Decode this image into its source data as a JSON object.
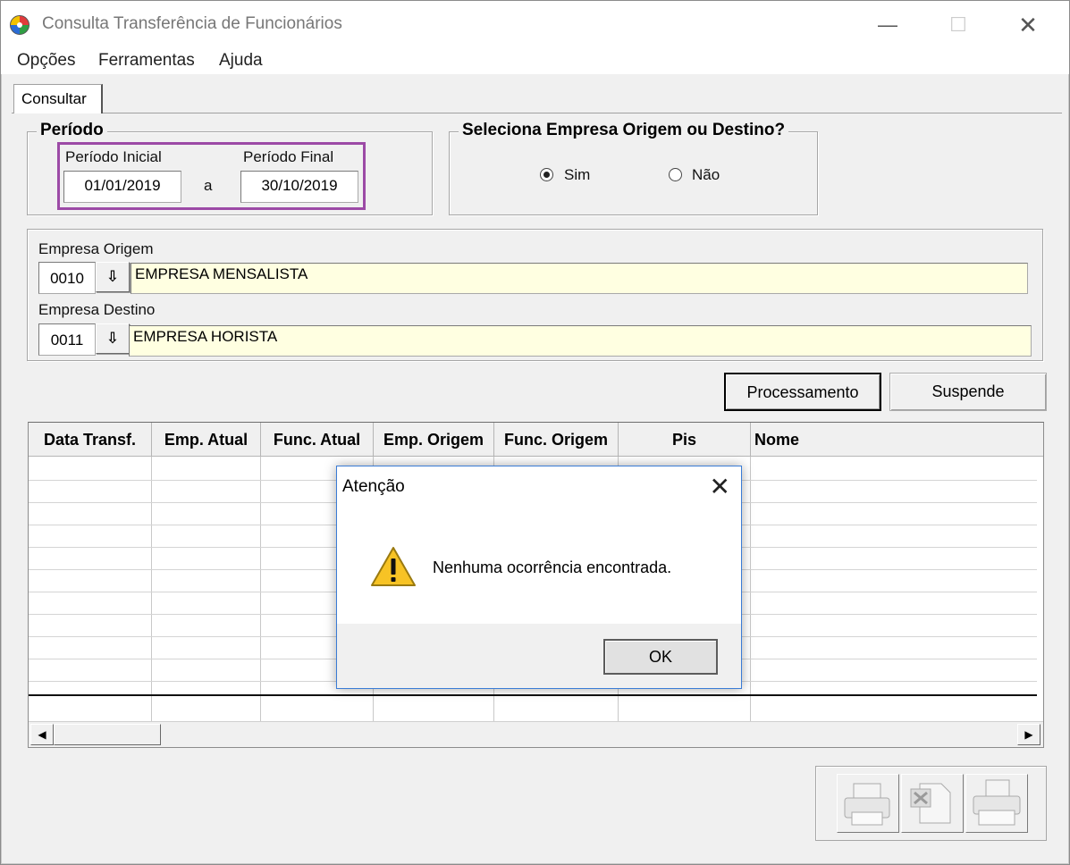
{
  "window": {
    "title": "Consulta Transferência de Funcionários"
  },
  "menu": [
    "Opções",
    "Ferramentas",
    "Ajuda"
  ],
  "tab": {
    "label": "Consultar"
  },
  "periodo": {
    "group_title": "Período",
    "inicial_label": "Período Inicial",
    "inicial_value": "01/01/2019",
    "separator": "a",
    "final_label": "Período Final",
    "final_value": "30/10/2019"
  },
  "seleciona": {
    "group_title": "Seleciona Empresa Origem ou Destino?",
    "option_sim": "Sim",
    "option_nao": "Não",
    "selected": "Sim"
  },
  "empresa_origem": {
    "label": "Empresa Origem",
    "code": "0010",
    "name": "EMPRESA MENSALISTA"
  },
  "empresa_destino": {
    "label": "Empresa Destino",
    "code": "0011",
    "name": "EMPRESA HORISTA"
  },
  "buttons": {
    "processamento": "Processamento",
    "suspende": "Suspende"
  },
  "grid": {
    "columns": [
      "Data Transf.",
      "Emp. Atual",
      "Func. Atual",
      "Emp. Origem",
      "Func. Origem",
      "Pis",
      "Nome"
    ]
  },
  "dialog": {
    "title": "Atenção",
    "message": "Nenhuma ocorrência encontrada.",
    "ok": "OK",
    "icon": "warning-icon"
  },
  "icons": {
    "scroll_left": "◀",
    "scroll_right": "▶",
    "dropdown": "⇩",
    "close": "✕",
    "minimize": "—",
    "maximize": "☐"
  }
}
